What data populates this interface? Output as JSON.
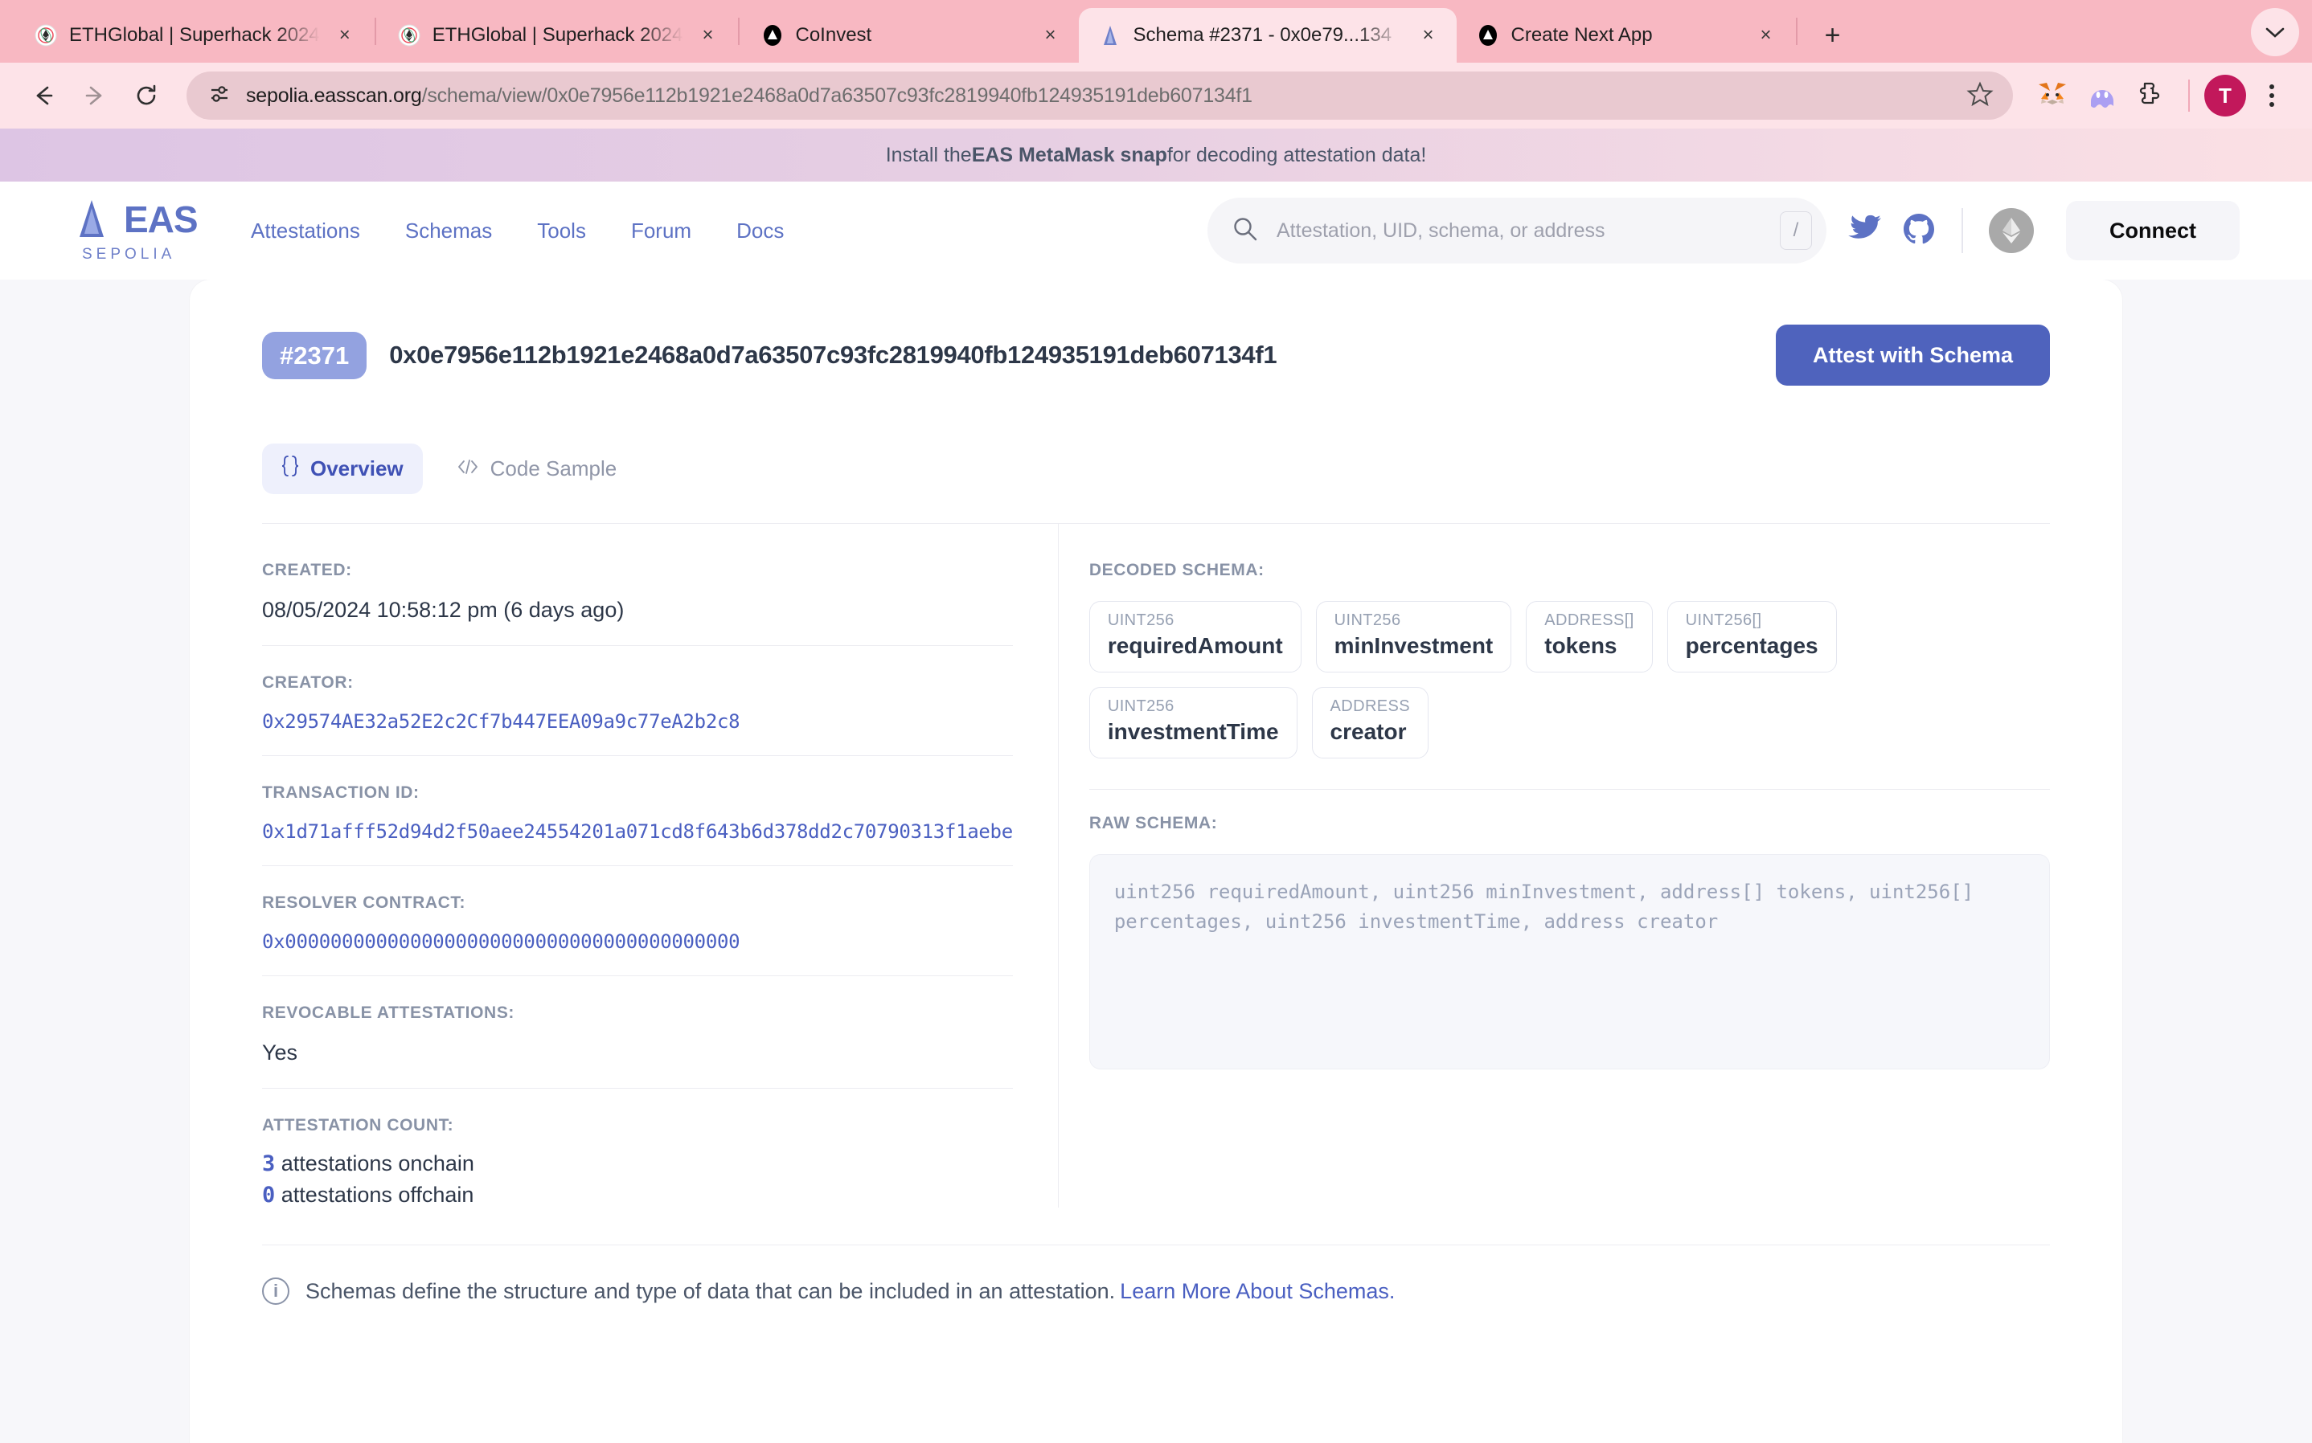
{
  "browser": {
    "tabs": [
      {
        "title": "ETHGlobal | Superhack 2024",
        "favicon": "ethglobal-icon",
        "active": false
      },
      {
        "title": "ETHGlobal | Superhack 2024",
        "favicon": "ethglobal-icon",
        "active": false
      },
      {
        "title": "CoInvest",
        "favicon": "vercel-triangle-icon",
        "active": false
      },
      {
        "title": "Schema #2371 - 0x0e79...134",
        "favicon": "eas-icon",
        "active": true
      },
      {
        "title": "Create Next App",
        "favicon": "vercel-triangle-icon",
        "active": false
      }
    ],
    "new_tab_label": "+",
    "close_label": "×",
    "tab_list_chevron": "chevron-down-icon",
    "url_domain": "sepolia.easscan.org",
    "url_path": "/schema/view/0x0e7956e112b1921e2468a0d7a63507c93fc2819940fb124935191deb607134f1",
    "avatar_letter": "T",
    "colors": {
      "tabstrip": "#f8b8c2",
      "toolbar": "#fde3e8",
      "omnibox": "#e9c9d0"
    }
  },
  "promo": {
    "prefix": "Install the ",
    "link": "EAS MetaMask snap",
    "suffix": " for decoding attestation data!"
  },
  "header": {
    "logo_text": "EAS",
    "logo_network": "SEPOLIA",
    "nav": [
      {
        "label": "Attestations"
      },
      {
        "label": "Schemas"
      },
      {
        "label": "Tools"
      },
      {
        "label": "Forum"
      },
      {
        "label": "Docs"
      }
    ],
    "search_placeholder": "Attestation, UID, schema, or address",
    "search_shortcut": "/",
    "connect_label": "Connect",
    "accent": "#5d72c4"
  },
  "schema": {
    "badge": "#2371",
    "uid": "0x0e7956e112b1921e2468a0d7a63507c93fc2819940fb124935191deb607134f1",
    "attest_button": "Attest with Schema",
    "tabs": [
      {
        "label": "Overview",
        "icon": "braces-icon",
        "active": true
      },
      {
        "label": "Code Sample",
        "icon": "code-tags-icon",
        "active": false
      }
    ],
    "fields": {
      "created_label": "CREATED:",
      "created_value": "08/05/2024 10:58:12 pm (6 days ago)",
      "creator_label": "CREATOR:",
      "creator_value": "0x29574AE32a52E2c2Cf7b447EEA09a9c77eA2b2c8",
      "transaction_label": "TRANSACTION ID:",
      "transaction_value": "0x1d71afff52d94d2f50aee24554201a071cd8f643b6d378dd2c70790313f1aebe",
      "resolver_label": "RESOLVER CONTRACT:",
      "resolver_value": "0x0000000000000000000000000000000000000000",
      "revocable_label": "REVOCABLE ATTESTATIONS:",
      "revocable_value": "Yes",
      "count_label": "ATTESTATION COUNT:",
      "onchain_count": "3",
      "onchain_text": "attestations onchain",
      "offchain_count": "0",
      "offchain_text": "attestations offchain"
    },
    "decoded_label": "DECODED SCHEMA:",
    "decoded": [
      {
        "type": "UINT256",
        "name": "requiredAmount"
      },
      {
        "type": "UINT256",
        "name": "minInvestment"
      },
      {
        "type": "ADDRESS[]",
        "name": "tokens"
      },
      {
        "type": "UINT256[]",
        "name": "percentages"
      },
      {
        "type": "UINT256",
        "name": "investmentTime"
      },
      {
        "type": "ADDRESS",
        "name": "creator"
      }
    ],
    "raw_label": "RAW SCHEMA:",
    "raw_value": "uint256 requiredAmount, uint256 minInvestment, address[] tokens, uint256[] percentages, uint256 investmentTime, address creator",
    "footer_text": "Schemas define the structure and type of data that can be included in an attestation. ",
    "footer_link": "Learn More About Schemas."
  }
}
